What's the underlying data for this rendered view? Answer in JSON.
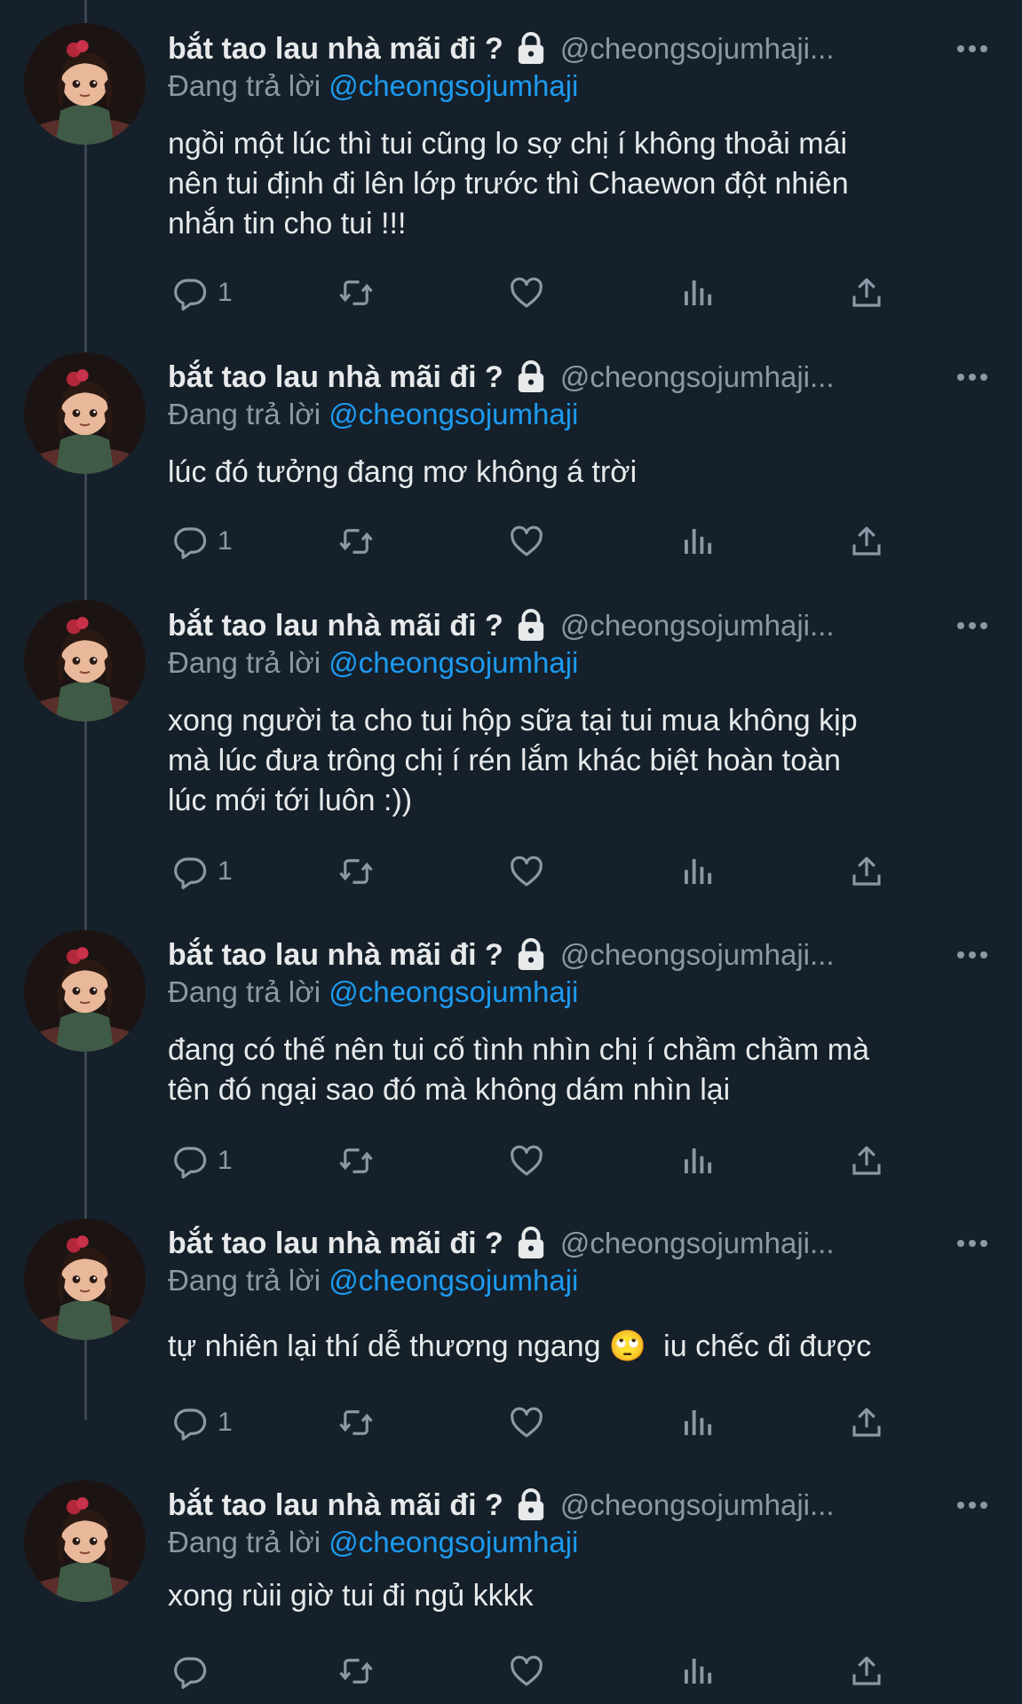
{
  "tweets": [
    {
      "name": "bắt tao lau nhà mãi đi ?",
      "handle": "@cheongsojumhaji...",
      "reply_prefix": "Đang trả lời",
      "reply_to": "@cheongsojumhaji",
      "text": "ngồi một lúc thì tui cũng lo sợ chị í không thoải mái\nnên tui định đi lên lớp trước thì Chaewon đột nhiên\nnhắn tin cho tui !!!",
      "reply_count": "1"
    },
    {
      "name": "bắt tao lau nhà mãi đi ?",
      "handle": "@cheongsojumhaji...",
      "reply_prefix": "Đang trả lời",
      "reply_to": "@cheongsojumhaji",
      "text": "lúc đó tưởng đang mơ không á trời",
      "reply_count": "1"
    },
    {
      "name": "bắt tao lau nhà mãi đi ?",
      "handle": "@cheongsojumhaji...",
      "reply_prefix": "Đang trả lời",
      "reply_to": "@cheongsojumhaji",
      "text": "xong người ta cho tui hộp sữa tại tui mua không kịp\nmà lúc đưa trông chị í rén lắm khác biệt hoàn toàn\nlúc mới tới luôn :))",
      "reply_count": "1"
    },
    {
      "name": "bắt tao lau nhà mãi đi ?",
      "handle": "@cheongsojumhaji...",
      "reply_prefix": "Đang trả lời",
      "reply_to": "@cheongsojumhaji",
      "text": "đang có thế nên tui cố tình nhìn chị í chầm chầm mà\ntên đó ngại sao đó mà không dám nhìn lại",
      "reply_count": "1"
    },
    {
      "name": "bắt tao lau nhà mãi đi ?",
      "handle": "@cheongsojumhaji...",
      "reply_prefix": "Đang trả lời",
      "reply_to": "@cheongsojumhaji",
      "text": "tự nhiên lại thí dễ thương ngang 🙄  iu chếc đi được",
      "reply_count": "1"
    },
    {
      "name": "bắt tao lau nhà mãi đi ?",
      "handle": "@cheongsojumhaji...",
      "reply_prefix": "Đang trả lời",
      "reply_to": "@cheongsojumhaji",
      "text": "xong rùii giờ tui đi ngủ kkkk",
      "reply_count": ""
    }
  ],
  "icons": {
    "avatar": "avatar-image",
    "lock": "lock-icon",
    "more": "more-icon",
    "reply": "reply-icon",
    "retweet": "retweet-icon",
    "like": "like-icon",
    "views": "views-icon",
    "share": "share-icon"
  },
  "colors": {
    "background": "#15202b",
    "text": "#e7e9ea",
    "secondary": "#8b98a5",
    "mention": "#1d9bf0",
    "thread_line": "#3d4650"
  }
}
